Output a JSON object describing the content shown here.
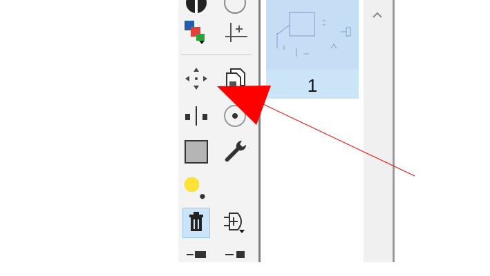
{
  "pages_panel": {
    "thumbnails": [
      {
        "page_number": "1",
        "selected": true
      }
    ]
  },
  "toolbar": {
    "tools": [
      {
        "icon": "half-circle-icon"
      },
      {
        "icon": "circle-outline-icon"
      },
      {
        "icon": "layers-color-icon"
      },
      {
        "icon": "origin-icon"
      },
      {
        "icon": "move-icon"
      },
      {
        "icon": "copy-icon"
      },
      {
        "icon": "mirror-icon"
      },
      {
        "icon": "snap-circle-icon"
      },
      {
        "icon": "gray-square-icon"
      },
      {
        "icon": "wrench-icon"
      },
      {
        "icon": "yellow-dot-icon"
      },
      {
        "icon": "delete-icon",
        "selected": true
      },
      {
        "icon": "add-pin-icon"
      }
    ]
  },
  "annotation": {
    "arrow_color": "#ff0000"
  },
  "colors": {
    "selection": "#cce4f7",
    "toolbar_bg": "#f3f3f3"
  }
}
